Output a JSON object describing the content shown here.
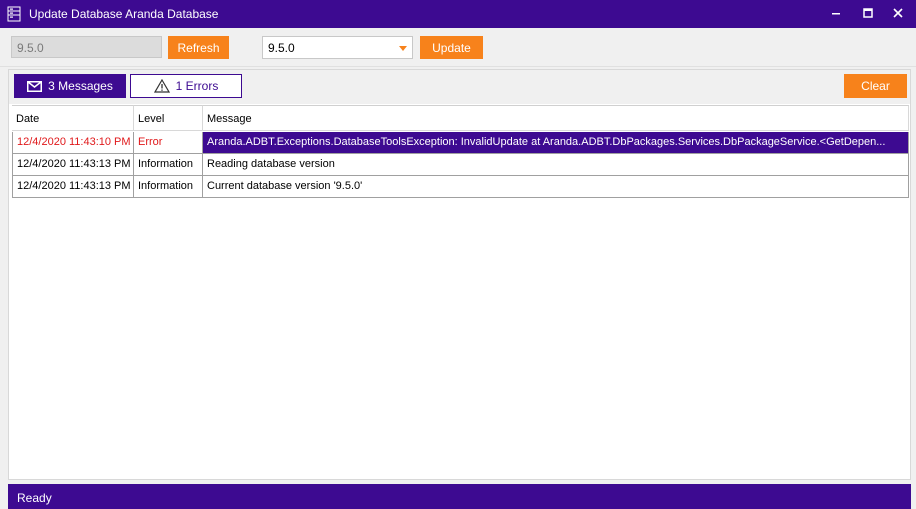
{
  "window": {
    "title": "Update Database Aranda Database",
    "icons": {
      "app": "server-database-icon",
      "minimize": "minimize-icon",
      "maximize": "maximize-icon",
      "close": "close-icon"
    }
  },
  "top_bar": {
    "current_version": "9.5.0",
    "refresh_label": "Refresh",
    "target_version": "9.5.0",
    "update_label": "Update"
  },
  "log": {
    "tabs": [
      {
        "label": "3 Messages",
        "icon": "envelope-icon"
      },
      {
        "label": "1 Errors",
        "icon": "warning-icon"
      }
    ],
    "clear_label": "Clear",
    "columns": [
      "Date",
      "Level",
      "Message"
    ],
    "rows": [
      {
        "date": "12/4/2020 11:43:10 PM",
        "level": "Error",
        "message": "Aranda.ADBT.Exceptions.DatabaseToolsException: InvalidUpdate    at Aranda.ADBT.DbPackages.Services.DbPackageService.<GetDepen..."
      },
      {
        "date": "12/4/2020 11:43:13 PM",
        "level": "Information",
        "message": "Reading database version"
      },
      {
        "date": "12/4/2020 11:43:13 PM",
        "level": "Information",
        "message": "Current database version '9.5.0'"
      }
    ]
  },
  "status": {
    "text": "Ready"
  },
  "colors": {
    "accent": "#3d0a91",
    "button": "#f7821b",
    "error": "#e0191b"
  }
}
